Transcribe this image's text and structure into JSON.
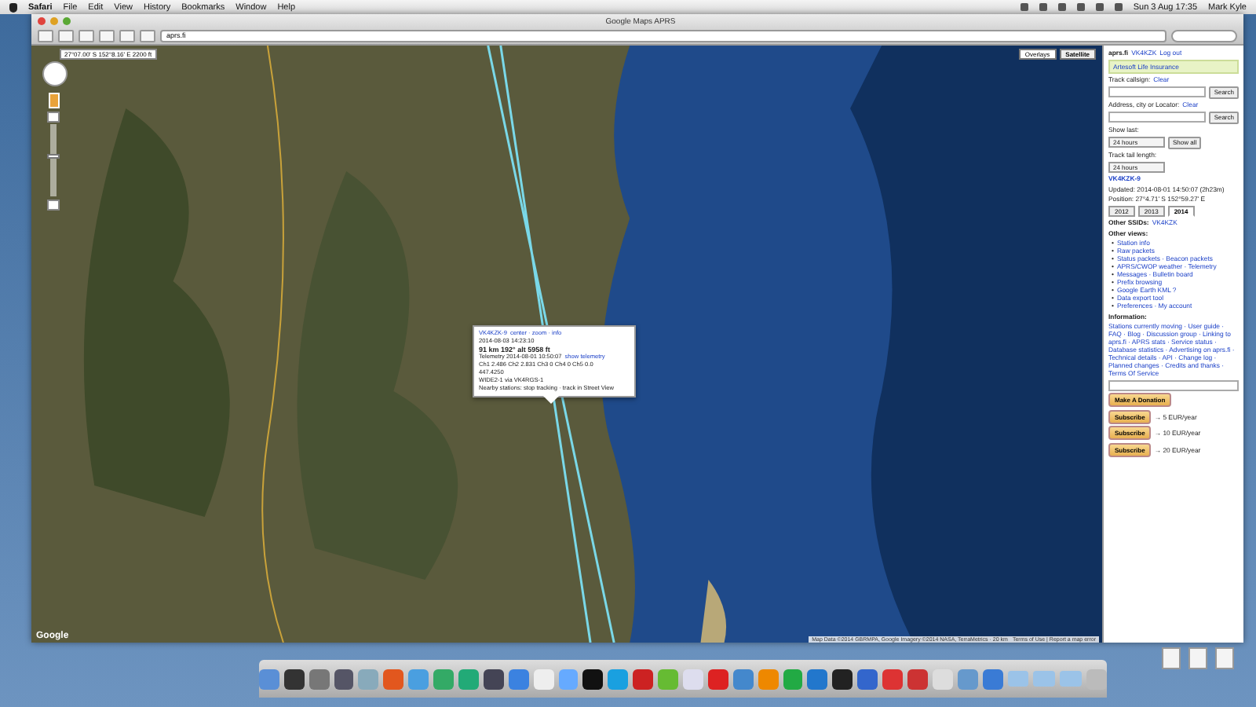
{
  "menu_bar": {
    "app": "Safari",
    "menus": [
      "File",
      "Edit",
      "View",
      "History",
      "Bookmarks",
      "Window",
      "Help"
    ],
    "clock": "Sun 3 Aug  17:35",
    "user": "Mark Kyle"
  },
  "window": {
    "title": "Google Maps APRS",
    "address": "aprs.fi"
  },
  "map": {
    "zoom": {
      "level": 0.55
    },
    "coordinates": "27°07.00' S 152°8.16' E 2200 ft",
    "map_types": [
      {
        "label": "Overlays",
        "selected": false
      },
      {
        "label": "Satellite",
        "selected": true
      }
    ],
    "logo": "Google",
    "attribution": "Map Data ©2014 GBRMPA, Google Imagery ©2014 NASA, TerraMetrics · 20 km",
    "terms": "Terms of Use | Report a map error",
    "popup": {
      "callsign": "VK4KZK-9",
      "links": "center · zoom · info",
      "time": "2014-08-03 14:23:10",
      "headline": "91 km 192° alt 5958 ft",
      "telemetry": "Telemetry 2014-08-01 10:50:07",
      "telemetry_link": "show telemetry",
      "channels": "Ch1 2.486 Ch2 2.831 Ch3 0 Ch4 0 Ch5 0.0",
      "frequency": "447.4250",
      "path": "WIDE2-1 via VK4RGS-1",
      "nearby": "Nearby stations: stop tracking · track in Street View"
    }
  },
  "sidebar": {
    "site": "aprs.fi",
    "account": "VK4KZK",
    "logout": "Log out",
    "ad_title": "Artesoft Life Insurance",
    "track_label": "Track callsign:",
    "clear_1": "Clear",
    "search_1": "Search",
    "address_label": "Address, city or Locator:",
    "clear_2": "Clear",
    "search_2": "Search",
    "show_last_label": "Show last:",
    "show_last": "24 hours",
    "show_all": "Show all",
    "tail_label": "Track tail length:",
    "tail": "24 hours",
    "station": "VK4KZK-9",
    "updated": "Updated: 2014-08-01 14:50:07 (2h23m)",
    "position": "Position: 27°4.71' S 152°59.27' E",
    "years": [
      {
        "label": "2012",
        "selected": false
      },
      {
        "label": "2013",
        "selected": false
      },
      {
        "label": "2014",
        "selected": true
      }
    ],
    "other_ssids_label": "Other SSIDs:",
    "other_ssid": "VK4KZK",
    "other_views_label": "Other views:",
    "bullet": "•",
    "other_views": [
      "Station info",
      "Raw packets",
      "Status packets · Beacon packets",
      "APRS/CWOP weather · Telemetry",
      "Messages · Bulletin board",
      "Prefix browsing",
      "Google Earth KML ?",
      "Data export tool",
      "Preferences · My account"
    ],
    "information_label": "Information:",
    "information": "Stations currently moving · User guide · FAQ · Blog · Discussion group · Linking to aprs.fi · APRS stats · Service status · Database statistics · Advertising on aprs.fi · Technical details · API · Change log · Planned changes · Credits and thanks · Terms Of Service",
    "donate": "Make A Donation",
    "subscriptions": [
      {
        "button": "Subscribe",
        "price": "→ 5 EUR/year"
      },
      {
        "button": "Subscribe",
        "price": "→ 10 EUR/year"
      },
      {
        "button": "Subscribe",
        "price": "→ 20 EUR/year"
      }
    ]
  }
}
